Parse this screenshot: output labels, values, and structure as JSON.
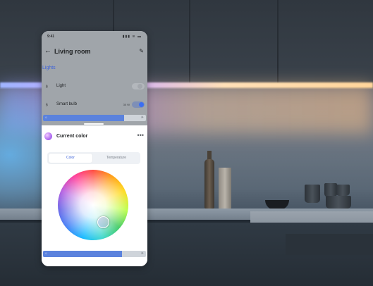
{
  "status_bar": {
    "time": "9:41",
    "icons": "▮▮▮ ≋ ▬"
  },
  "header": {
    "back_icon": "arrow-left-icon",
    "title": "Living room",
    "edit_icon": "pencil-icon"
  },
  "section_label": "Lights",
  "devices": [
    {
      "label": "Light",
      "icon": "light-bulb-icon",
      "watt": "",
      "on": false
    },
    {
      "label": "Smart bulb",
      "icon": "light-bulb-icon",
      "watt": "30 W",
      "on": true
    }
  ],
  "brightness_top": {
    "value": 0.79,
    "low_icon": "sun-small-icon",
    "high_icon": "sun-large-icon"
  },
  "current_color": {
    "title": "Current color",
    "more_label": "•••"
  },
  "tabs": [
    {
      "label": "Color",
      "active": true
    },
    {
      "label": "Temperature",
      "active": false
    }
  ],
  "brightness_bottom": {
    "value": 0.77,
    "low_icon": "sun-small-icon",
    "high_icon": "sun-large-icon"
  },
  "colors": {
    "accent": "#3e63d9",
    "toggle_on": "#3b6ef2",
    "slider_fill": "#5b82dd"
  }
}
